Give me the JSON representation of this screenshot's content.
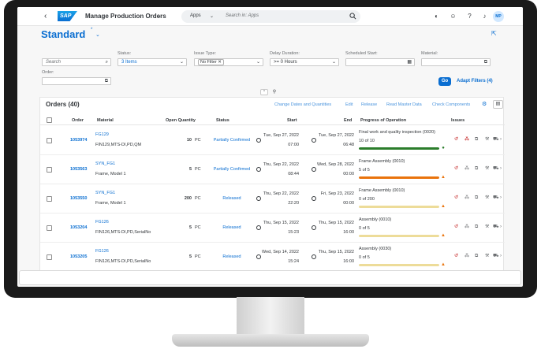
{
  "shell": {
    "title": "Manage Production Orders",
    "logo_text": "SAP",
    "search_scope": "Apps",
    "search_placeholder": "Search in: Apps",
    "avatar_initials": "MP"
  },
  "header": {
    "variant": "Standard",
    "variant_modified": "*"
  },
  "filters": {
    "search_placeholder": "Search",
    "status_label": "Status:",
    "status_value": "3 Items",
    "issue_label": "Issue Type:",
    "issue_token": "No Filter",
    "delay_label": "Delay Duration:",
    "delay_value": ">= 0 Hours",
    "start_label": "Scheduled Start:",
    "material_label": "Material:",
    "order_label": "Order:",
    "go_label": "Go",
    "adapt_label": "Adapt Filters (4)"
  },
  "table": {
    "title": "Orders (40)",
    "toolbar": [
      "Change Dates and Quantities",
      "Edit",
      "Release",
      "Read Master Data",
      "Check Components"
    ],
    "columns": {
      "order": "Order",
      "material": "Material",
      "open_qty": "Open Quantity",
      "status": "Status",
      "start": "Start",
      "end": "End",
      "progress": "Progress of Operation",
      "issues": "Issues"
    },
    "rows": [
      {
        "order": "1053974",
        "material": "FG129",
        "material_desc": "FIN129,MTS-DI,PD,QM",
        "qty": "10",
        "unit": "PC",
        "status": "Partially Confirmed",
        "start_date": "Tue, Sep 27, 2022",
        "start_time": "07:00",
        "end_date": "Tue, Sep 27, 2022",
        "end_time": "06:48",
        "op": "Final work and quality inspection (0020)",
        "op_count": "10 of 10",
        "progress": 1.0,
        "progress_color": "#2b7d2b",
        "state": "success"
      },
      {
        "order": "1053563",
        "material": "SYN_FG1",
        "material_desc": "Frame, Model 1",
        "qty": "5",
        "unit": "PC",
        "status": "Partially Confirmed",
        "start_date": "Thu, Sep 22, 2022",
        "start_time": "08:44",
        "end_date": "Wed, Sep 28, 2022",
        "end_time": "00:00",
        "op": "Frame Assembly (0010)",
        "op_count": "5 of 5",
        "progress": 1.0,
        "progress_color": "#e9730c",
        "state": "warning"
      },
      {
        "order": "1053550",
        "material": "SYN_FG1",
        "material_desc": "Frame, Model 1",
        "qty": "200",
        "unit": "PC",
        "status": "Released",
        "start_date": "Thu, Sep 22, 2022",
        "start_time": "22:20",
        "end_date": "Fri, Sep 23, 2022",
        "end_time": "00:00",
        "op": "Frame Assembly (0010)",
        "op_count": "0 of 200",
        "progress": 0.0,
        "progress_color": "#f0c000",
        "state": "warning"
      },
      {
        "order": "1053204",
        "material": "FG126",
        "material_desc": "FIN126,MTS-DI,PD,SerialNo",
        "qty": "5",
        "unit": "PC",
        "status": "Released",
        "start_date": "Thu, Sep 15, 2022",
        "start_time": "15:23",
        "end_date": "Thu, Sep 15, 2022",
        "end_time": "16:00",
        "op": "Assembly (0010)",
        "op_count": "0 of 5",
        "progress": 0.0,
        "progress_color": "#f0c000",
        "state": "warning"
      },
      {
        "order": "1053205",
        "material": "FG126",
        "material_desc": "FIN126,MTS-DI,PD,SerialNo",
        "qty": "5",
        "unit": "PC",
        "status": "Released",
        "start_date": "Wed, Sep 14, 2022",
        "start_time": "15:24",
        "end_date": "Thu, Sep 15, 2022",
        "end_time": "16:00",
        "op": "Assembly (0030)",
        "op_count": "0 of 5",
        "progress": 0.0,
        "progress_color": "#f0c000",
        "state": "warning"
      }
    ]
  },
  "colors": {
    "brand": "#0a6ed1",
    "success": "#2b7d2b",
    "warning": "#e9730c",
    "error": "#bb0000"
  },
  "icons": [
    "back-icon",
    "search-icon",
    "settings-icon",
    "help-icon",
    "notification-icon",
    "share-icon",
    "clock-icon",
    "delay-icon",
    "hierarchy-icon",
    "components-icon",
    "tools-icon",
    "truck-icon"
  ]
}
